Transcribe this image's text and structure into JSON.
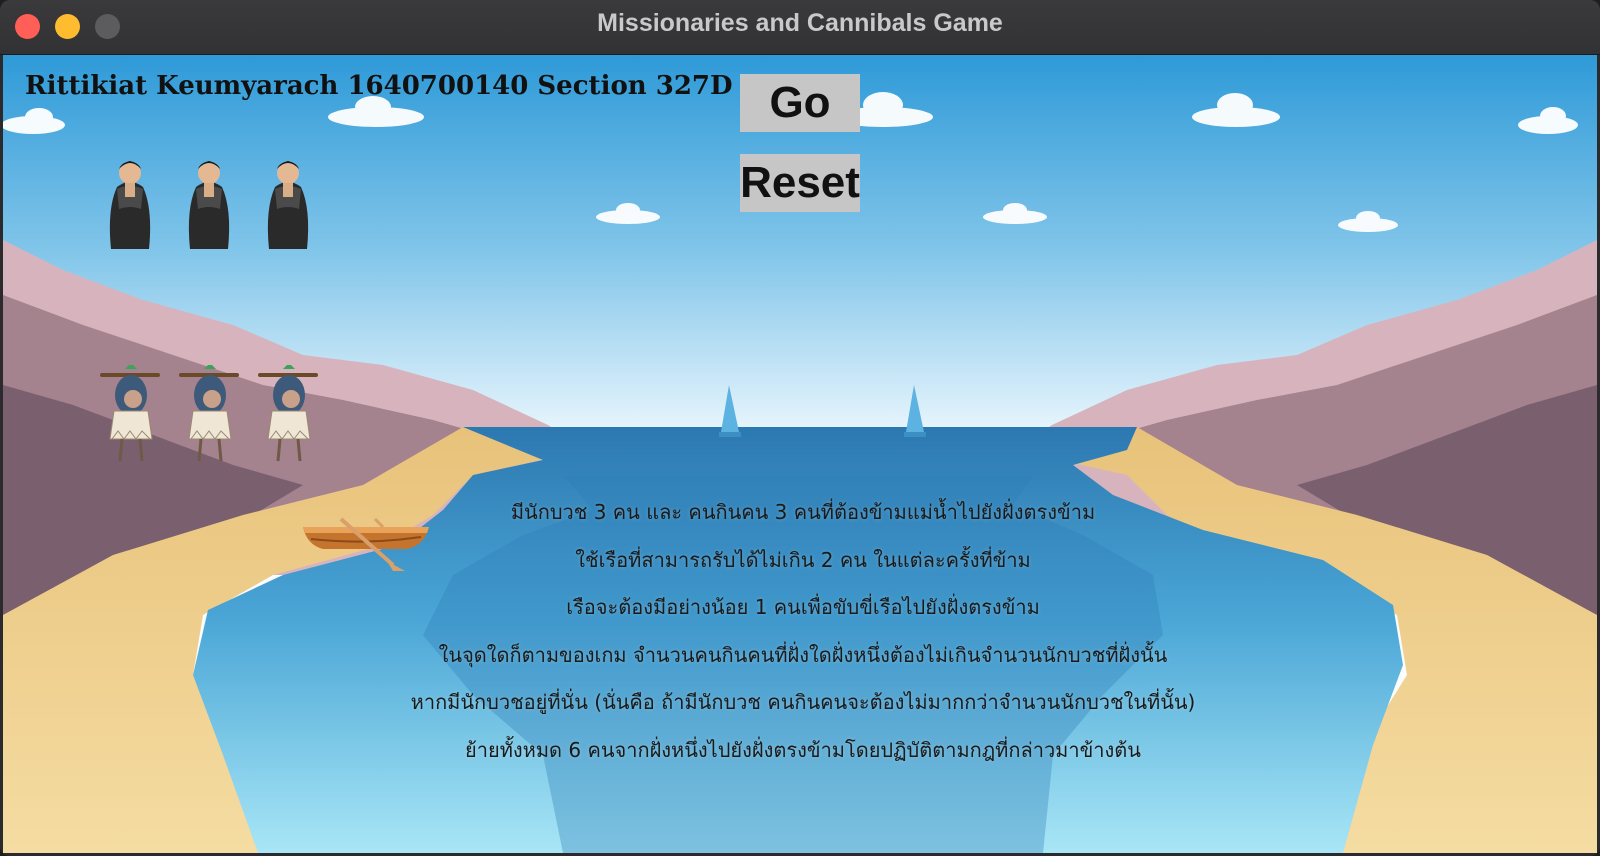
{
  "window": {
    "title": "Missionaries and Cannibals Game"
  },
  "header": {
    "student_info": "Rittikiat Keumyarach 1640700140 Section 327D"
  },
  "controls": {
    "go_label": "Go",
    "reset_label": "Reset"
  },
  "game_state": {
    "left_bank": {
      "missionaries": 3,
      "cannibals": 3
    },
    "right_bank": {
      "missionaries": 0,
      "cannibals": 0
    },
    "boat_side": "left"
  },
  "rules": [
    "มีนักบวช 3 คน และ คนกินคน 3 คนที่ต้องข้ามแม่น้ำไปยังฝั่งตรงข้าม",
    "ใช้เรือที่สามารถรับได้ไม่เกิน 2 คน ในแต่ละครั้งที่ข้าม",
    "เรือจะต้องมีอย่างน้อย 1 คนเพื่อขับขี่เรือไปยังฝั่งตรงข้าม",
    "ในจุดใดก็ตามของเกม จำนวนคนกินคนที่ฝั่งใดฝั่งหนึ่งต้องไม่เกินจำนวนนักบวชที่ฝั่งนั้น",
    "หากมีนักบวชอยู่ที่นั่น (นั่นคือ ถ้ามีนักบวช คนกินคนจะต้องไม่มากกว่าจำนวนนักบวชในที่นั้น)",
    "ย้ายทั้งหมด 6 คนจากฝั่งหนึ่งไปยังฝั่งตรงข้ามโดยปฏิบัติตามกฎที่กล่าวมาข้างต้น"
  ],
  "colors": {
    "sky_top": "#2e9ad8",
    "sky_bottom": "#ffffff",
    "water_dark": "#2f7fb8",
    "water_light": "#7ed3f0",
    "sand": "#f1cf8a",
    "rock": "#8a6f7f",
    "button_bg": "#c6c6c6"
  }
}
